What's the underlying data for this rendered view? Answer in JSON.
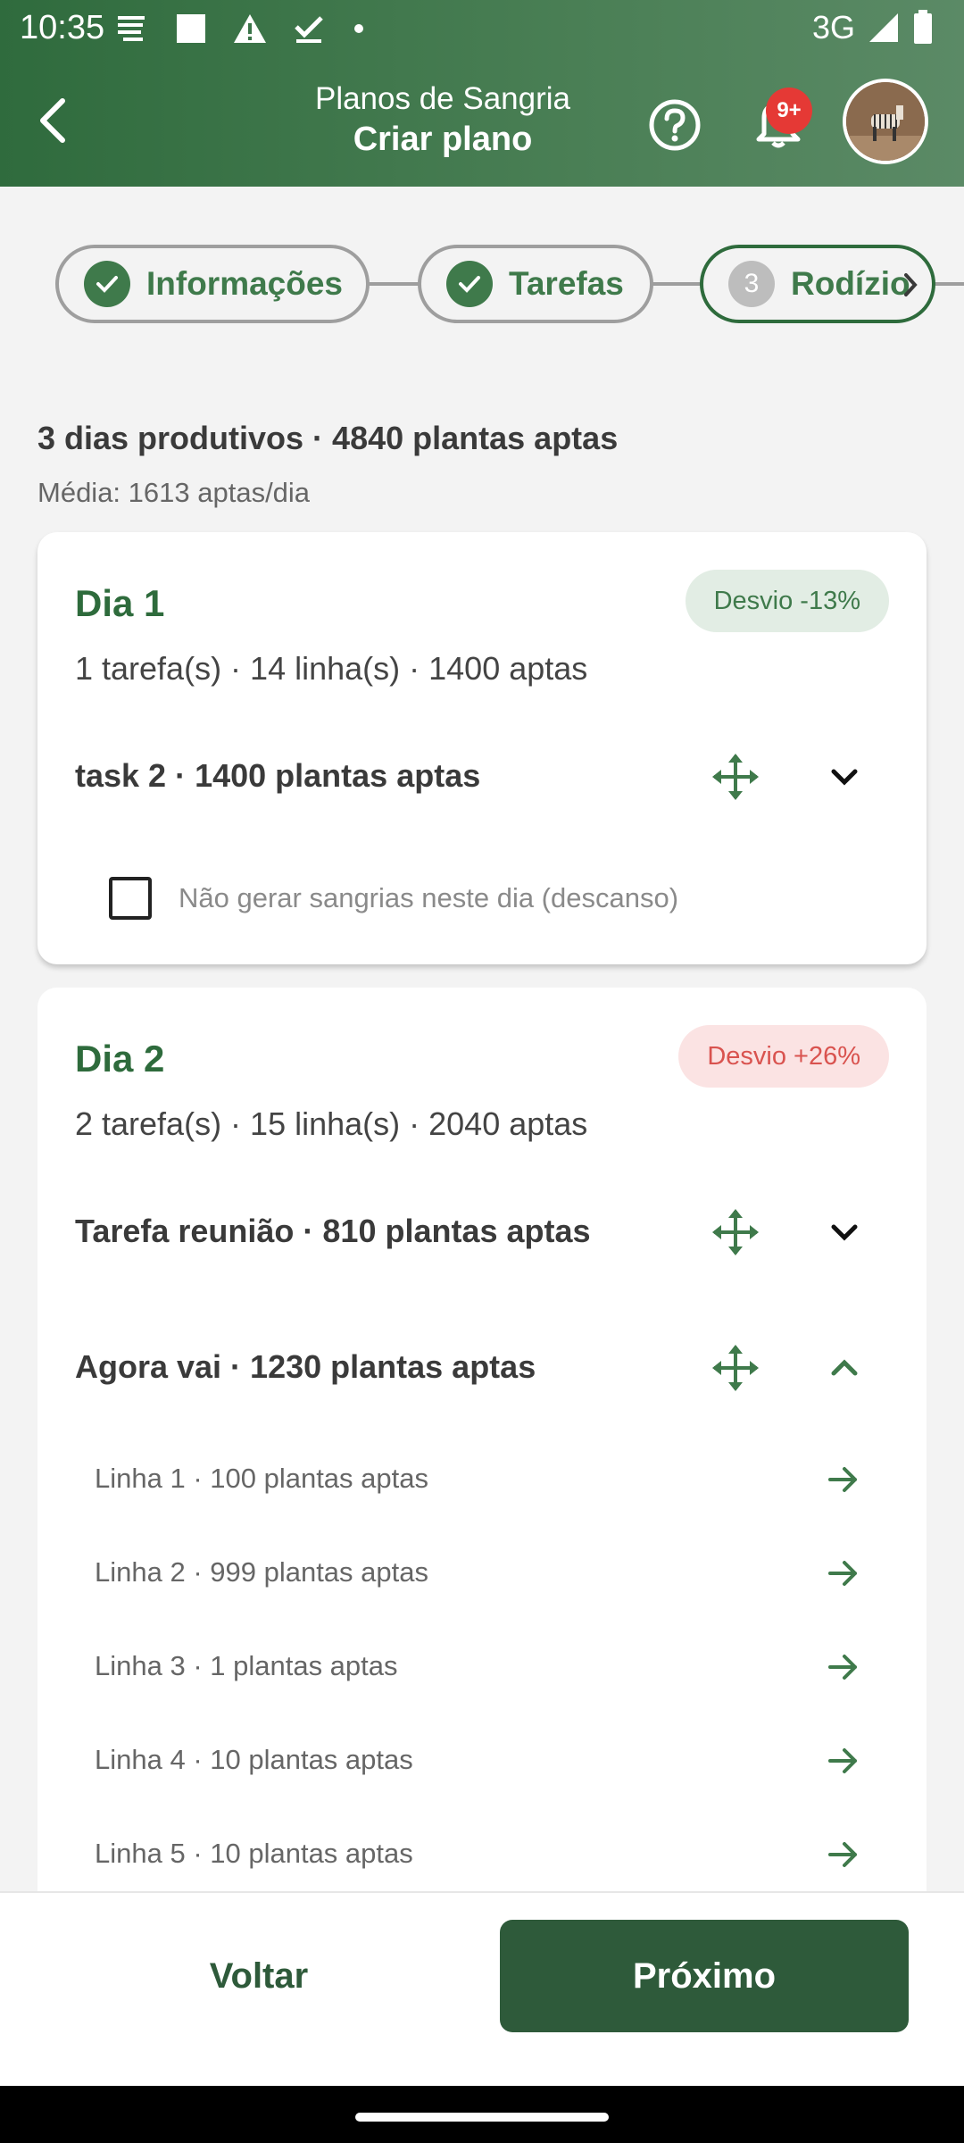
{
  "status_bar": {
    "time": "10:35",
    "network": "3G"
  },
  "header": {
    "subtitle": "Planos de Sangria",
    "title": "Criar plano",
    "notification_badge": "9+"
  },
  "stepper": {
    "steps": [
      {
        "label": "Informações",
        "state": "done"
      },
      {
        "label": "Tarefas",
        "state": "done"
      },
      {
        "number": "3",
        "label": "Rodízio",
        "state": "active"
      }
    ]
  },
  "summary": {
    "headline": "3 dias produtivos · 4840 plantas aptas",
    "average": "Média: 1613 aptas/dia"
  },
  "days": [
    {
      "title": "Dia 1",
      "deviation": "Desvio -13%",
      "deviation_color": "#3f7a4b",
      "info": "1 tarefa(s) · 14 linha(s) · 1400 aptas",
      "tasks": [
        {
          "label": "task 2 · 1400 plantas aptas",
          "expanded": false
        }
      ],
      "rest_label": "Não gerar sangrias neste dia (descanso)",
      "rest_checked": false
    },
    {
      "title": "Dia 2",
      "deviation": "Desvio +26%",
      "deviation_color": "#d9534f",
      "info": "2 tarefa(s) · 15 linha(s) · 2040 aptas",
      "tasks": [
        {
          "label": "Tarefa reunião · 810 plantas aptas",
          "expanded": false
        },
        {
          "label": "Agora vai · 1230 plantas aptas",
          "expanded": true,
          "lines": [
            "Linha 1 · 100 plantas aptas",
            "Linha 2 · 999 plantas aptas",
            "Linha 3 · 1 plantas aptas",
            "Linha 4 · 10 plantas aptas",
            "Linha 5 · 10 plantas aptas"
          ]
        }
      ]
    }
  ],
  "footer": {
    "back_label": "Voltar",
    "next_label": "Próximo"
  },
  "colors": {
    "brand": "#2e5a3a",
    "accent": "#3f7a4b",
    "header": "#4a7f55"
  }
}
